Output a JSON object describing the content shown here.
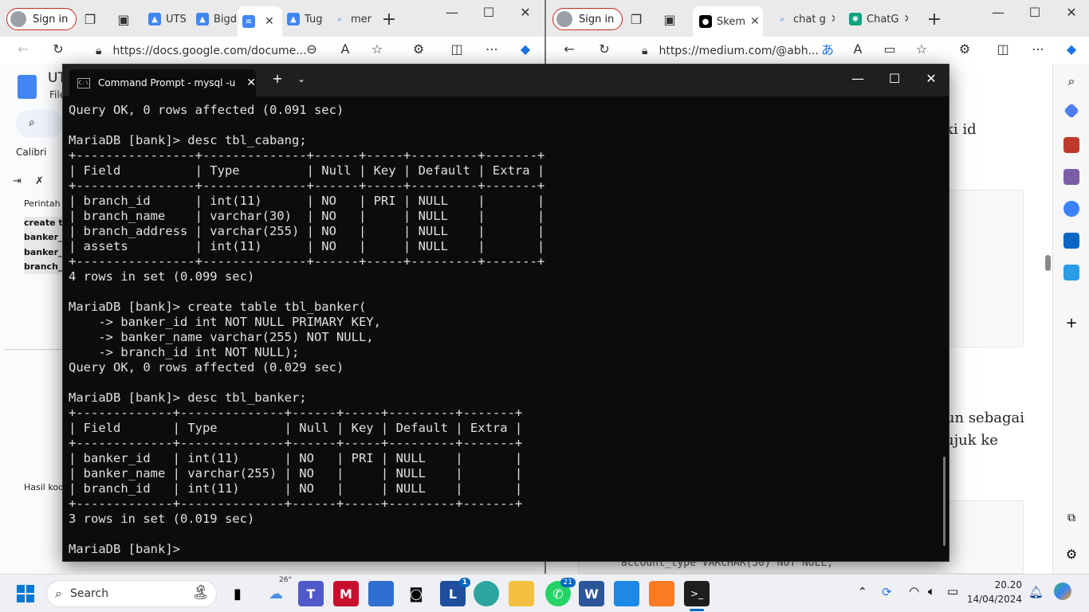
{
  "left_browser": {
    "signin": "Sign in",
    "tabs": [
      {
        "label": "UTS",
        "color": "#4285f4"
      },
      {
        "label": "Bigd",
        "color": "#4285f4"
      },
      {
        "label": "",
        "color": "#4285f4"
      },
      {
        "label": "Tug",
        "color": "#4285f4"
      },
      {
        "label": "mer",
        "color": "#1a73e8"
      }
    ],
    "url": "https://docs.google.com/docume...",
    "doc": {
      "title": "UT",
      "menu": "File",
      "font": "Calibri",
      "lines": [
        "Perintah",
        "create ta",
        "banker_i",
        "banker_r",
        "branch_i",
        "Hasil kod"
      ]
    }
  },
  "right_browser": {
    "signin": "Sign in",
    "tabs": [
      {
        "label": "Skem",
        "color": "#000000"
      },
      {
        "label": "chat g",
        "color": "#1a73e8"
      },
      {
        "label": "ChatG",
        "color": "#10a37f"
      }
    ],
    "url": "https://medium.com/@abh...",
    "article": {
      "text1": "ki id",
      "text2": "kun sebagai",
      "text3": "ujuk ke",
      "text4": ")",
      "code": "account_type VARCHAR(30) NOT NULL,"
    }
  },
  "terminal": {
    "tab_title": "Command Prompt - mysql  -u",
    "output": "Query OK, 0 rows affected (0.091 sec)\n\nMariaDB [bank]> desc tbl_cabang;\n+----------------+--------------+------+-----+---------+-------+\n| Field          | Type         | Null | Key | Default | Extra |\n+----------------+--------------+------+-----+---------+-------+\n| branch_id      | int(11)      | NO   | PRI | NULL    |       |\n| branch_name    | varchar(30)  | NO   |     | NULL    |       |\n| branch_address | varchar(255) | NO   |     | NULL    |       |\n| assets         | int(11)      | NO   |     | NULL    |       |\n+----------------+--------------+------+-----+---------+-------+\n4 rows in set (0.099 sec)\n\nMariaDB [bank]> create table tbl_banker(\n    -> banker_id int NOT NULL PRIMARY KEY,\n    -> banker_name varchar(255) NOT NULL,\n    -> branch_id int NOT NULL);\nQuery OK, 0 rows affected (0.029 sec)\n\nMariaDB [bank]> desc tbl_banker;\n+-------------+--------------+------+-----+---------+-------+\n| Field       | Type         | Null | Key | Default | Extra |\n+-------------+--------------+------+-----+---------+-------+\n| banker_id   | int(11)      | NO   | PRI | NULL    |       |\n| banker_name | varchar(255) | NO   |     | NULL    |       |\n| branch_id   | int(11)      | NO   |     | NULL    |       |\n+-------------+--------------+------+-----+---------+-------+\n3 rows in set (0.019 sec)\n\nMariaDB [bank]> "
  },
  "taskbar": {
    "search": "Search",
    "weather": "26°",
    "badge_l": "1",
    "badge_whatsapp": "21",
    "time": "20.20",
    "date": "14/04/2024"
  }
}
